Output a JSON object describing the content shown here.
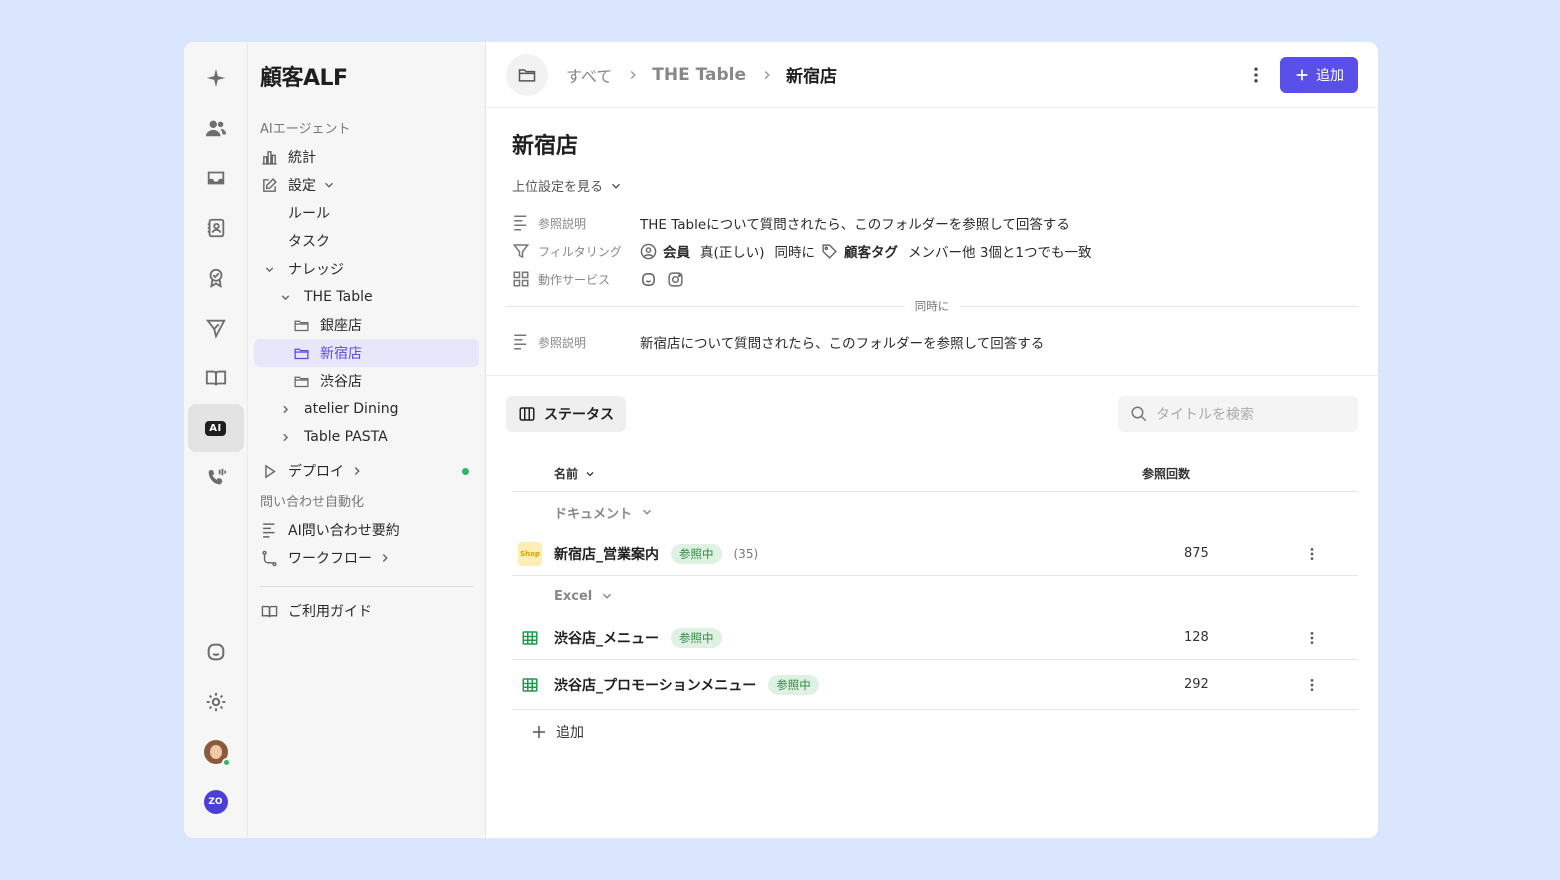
{
  "app": {
    "title": "顧客ALF"
  },
  "sidebar": {
    "section_ai": "AIエージェント",
    "stats": "統計",
    "settings": "設定",
    "rules": "ルール",
    "tasks": "タスク",
    "knowledge": "ナレッジ",
    "the_table": "THE Table",
    "ginza": "銀座店",
    "shinjuku": "新宿店",
    "shibuya": "渋谷店",
    "atelier": "atelier Dining",
    "pasta": "Table PASTA",
    "deploy": "デプロイ",
    "section_auto": "問い合わせ自動化",
    "summary": "AI問い合わせ要約",
    "workflow": "ワークフロー",
    "guide": "ご利用ガイド"
  },
  "breadcrumb": {
    "all": "すべて",
    "parent": "THE Table",
    "current": "新宿店"
  },
  "toolbar": {
    "add_label": "追加"
  },
  "header": {
    "title": "新宿店",
    "upper_settings": "上位設定を見る",
    "ref_desc_label": "参照説明",
    "ref_desc_value": "THE Tableについて質問されたら、このフォルダーを参照して回答する",
    "filter_label": "フィルタリング",
    "filter_member": "会員",
    "filter_true": "真(正しい)",
    "filter_and": "同時に",
    "filter_tag": "顧客タグ",
    "filter_tag_value": "メンバー他 3個と1つでも一致",
    "service_label": "動作サービス",
    "simultaneous": "同時に",
    "ref_desc2_label": "参照説明",
    "ref_desc2_value": "新宿店について質問されたら、このフォルダーを参照して回答する"
  },
  "tools": {
    "status": "ステータス",
    "search_placeholder": "タイトルを検索"
  },
  "table": {
    "col_name": "名前",
    "col_count": "参照回数",
    "groups": [
      {
        "label": "ドキュメント",
        "rows": [
          {
            "name": "新宿店_営業案内",
            "tag": "参照中",
            "sub": "(35)",
            "count": "875",
            "icon": "shop-icon"
          }
        ]
      },
      {
        "label": "Excel",
        "rows": [
          {
            "name": "渋谷店_メニュー",
            "tag": "参照中",
            "count": "128",
            "icon": "spreadsheet-icon"
          },
          {
            "name": "渋谷店_プロモーションメニュー",
            "tag": "参照中",
            "count": "292",
            "icon": "spreadsheet-icon"
          }
        ]
      }
    ],
    "add_label": "追加"
  },
  "icons": {
    "shop_text": "Shop",
    "ai_badge": "AI",
    "zo": "ZO"
  },
  "colors": {
    "accent": "#5b4fe9",
    "tag_bg": "#dff1e3",
    "tag_fg": "#2e8a44",
    "page_bg": "#d9e6fd"
  }
}
